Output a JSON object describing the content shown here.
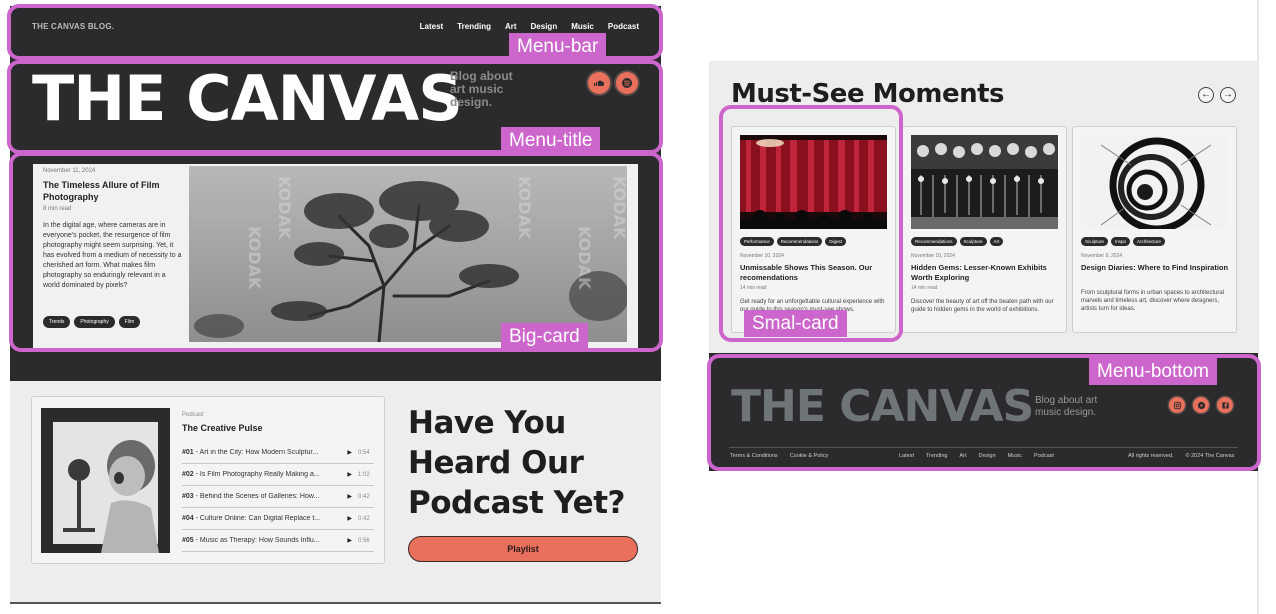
{
  "left_mockup": {
    "menu_bar": {
      "brand": "THE CANVAS BLOG.",
      "nav": [
        "Latest",
        "Trending",
        "Art",
        "Design",
        "Music",
        "Podcast"
      ]
    },
    "title_block": {
      "title": "THE CANVAS",
      "tagline": "Blog about art music design.",
      "social_icons": [
        "soundcloud-icon",
        "spotify-icon"
      ]
    },
    "big_card": {
      "date": "November 11, 2024",
      "title": "The Timeless Allure of Film Photography",
      "read_time": "8 min read",
      "body": "In the digital age, where cameras are in everyone's pocket, the resurgence of film photography might seem surprising. Yet, it has evolved from a medium of necessity to a cherished art form. What makes film photography so enduringly relevant in a world dominated by pixels?",
      "tags": [
        "Trends",
        "Photography",
        "Film"
      ]
    },
    "podcast": {
      "label": "Podcast",
      "title": "The Creative Pulse",
      "episodes": [
        {
          "num": "#01",
          "title": " - Art in the City: How Modern Sculptur...",
          "time": "0:54"
        },
        {
          "num": "#02",
          "title": " - Is Film Photography Really Making a...",
          "time": "1:02"
        },
        {
          "num": "#03",
          "title": " - Behind the Scenes of Galleries: How...",
          "time": "0:42"
        },
        {
          "num": "#04",
          "title": " - Culture Online: Can Digital Replace t...",
          "time": "0:42"
        },
        {
          "num": "#05",
          "title": " - Music as Therapy: How Sounds Influ...",
          "time": "0:56"
        }
      ],
      "heading": "Have You Heard Our Podcast Yet?",
      "button": "Playlist"
    }
  },
  "right_mockup": {
    "section_title": "Must-See Moments",
    "arrows": {
      "prev": "←",
      "next": "→"
    },
    "cards": [
      {
        "tags": [
          "Performance",
          "Recommendations",
          "Digest"
        ],
        "date": "November 10, 2024",
        "title": "Unmissable Shows This Season. Our recomendations",
        "read_time": "14 min read",
        "body": "Get ready for an unforgettable cultural experience with our guide to this season's must-see shows."
      },
      {
        "tags": [
          "Recommendations",
          "Sculpture",
          "Art"
        ],
        "date": "November 10, 2024",
        "title": "Hidden Gems: Lesser-Known Exhibits Worth Exploring",
        "read_time": "14 min read",
        "body": "Discover the beauty of art off the beaten path with our guide to hidden gems in the world of exhibitions."
      },
      {
        "tags": [
          "Sculpture",
          "Inspo",
          "Architecture"
        ],
        "date": "November 9, 2024",
        "title": "Design Diaries: Where to Find Inspiration",
        "read_time": "",
        "body": "From sculptural forms in urban spaces to architectural marvels and timeless art, discover where designers, artists turn for ideas."
      }
    ],
    "footer": {
      "title": "THE CANVAS",
      "tagline": "Blog about art music design.",
      "social_icons": [
        "instagram-icon",
        "youtube-icon",
        "facebook-icon"
      ],
      "legal_links": [
        "Terms & Conditions",
        "Cookie & Policy"
      ],
      "nav": [
        "Latest",
        "Trending",
        "Art",
        "Design",
        "Music",
        "Podcast"
      ],
      "rights": "All rights reserved.",
      "copyright": "© 2024 The Canvas"
    }
  },
  "annotations": {
    "menu_bar": "Menu-bar",
    "menu_title": "Menu-title",
    "big_card": "Big-card",
    "small_card": "Smal-card",
    "menu_bottom": "Menu-bottom"
  },
  "colors": {
    "dark_bg": "#2b2a2c",
    "accent": "#e9705c",
    "annotation": "#cc66cc",
    "light_bg": "#ededed"
  }
}
